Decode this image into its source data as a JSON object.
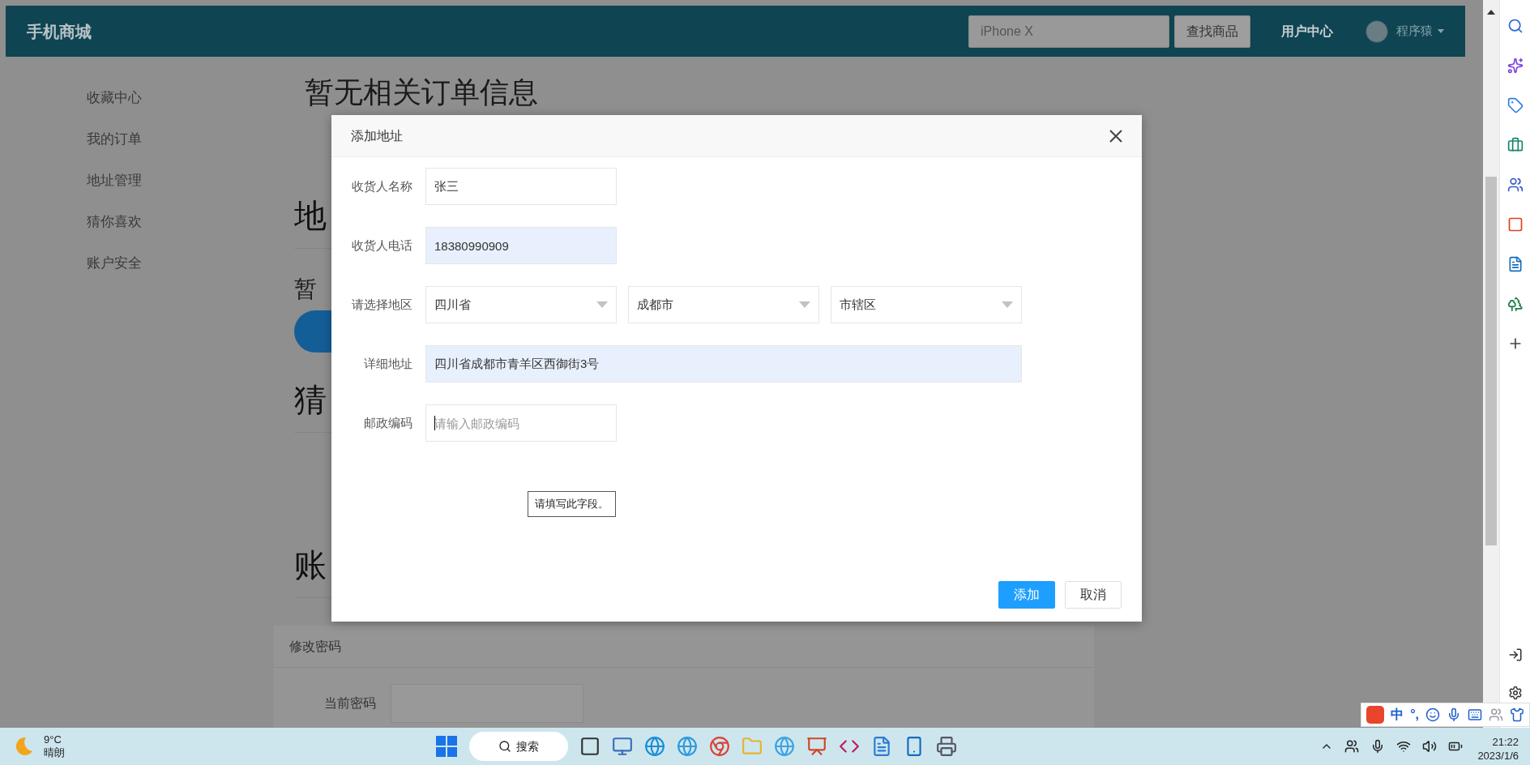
{
  "header": {
    "logo": "手机商城",
    "search": {
      "placeholder": "iPhone X"
    },
    "search_button": "查找商品",
    "user_center": "用户中心",
    "username": "程序猿"
  },
  "sidebar": {
    "items": [
      {
        "label": "收藏中心"
      },
      {
        "label": "我的订单"
      },
      {
        "label": "地址管理"
      },
      {
        "label": "猜你喜欢"
      },
      {
        "label": "账户安全"
      }
    ]
  },
  "page": {
    "orders_empty": "暂无相关订单信息",
    "blocks": [
      {
        "kind": "heading",
        "text": "地"
      },
      {
        "kind": "text",
        "text": "暂"
      },
      {
        "kind": "button"
      },
      {
        "kind": "heading",
        "text": "猜"
      },
      {
        "kind": "spacer"
      },
      {
        "kind": "heading",
        "text": "账"
      }
    ]
  },
  "password_panel": {
    "title": "修改密码",
    "fields": [
      {
        "label": "当前密码"
      }
    ]
  },
  "dialog": {
    "title": "添加地址",
    "fields": [
      {
        "kind": "input",
        "label": "收货人名称",
        "value": "张三",
        "autofilled": false
      },
      {
        "kind": "input",
        "label": "收货人电话",
        "value": "18380990909",
        "autofilled": true
      },
      {
        "kind": "selects",
        "label": "请选择地区",
        "options": [
          "四川省",
          "成都市",
          "市辖区"
        ]
      },
      {
        "kind": "wide_input",
        "label": "详细地址",
        "value": "四川省成都市青羊区西御街3号",
        "autofilled": true
      },
      {
        "kind": "input",
        "label": "邮政编码",
        "placeholder": "请输入邮政编码",
        "autofilled": false,
        "focused": true
      }
    ],
    "tooltip": "请填写此字段。",
    "buttons": [
      {
        "label": "添加",
        "primary": true
      },
      {
        "label": "取消",
        "primary": false
      }
    ]
  },
  "ime_bar": {
    "items": [
      "中",
      "°,"
    ]
  },
  "taskbar": {
    "weather": {
      "temp": "9°C",
      "condition": "晴朗"
    },
    "search": "搜索",
    "clock": {
      "time": "21:22",
      "date": "2023/1/6"
    }
  }
}
